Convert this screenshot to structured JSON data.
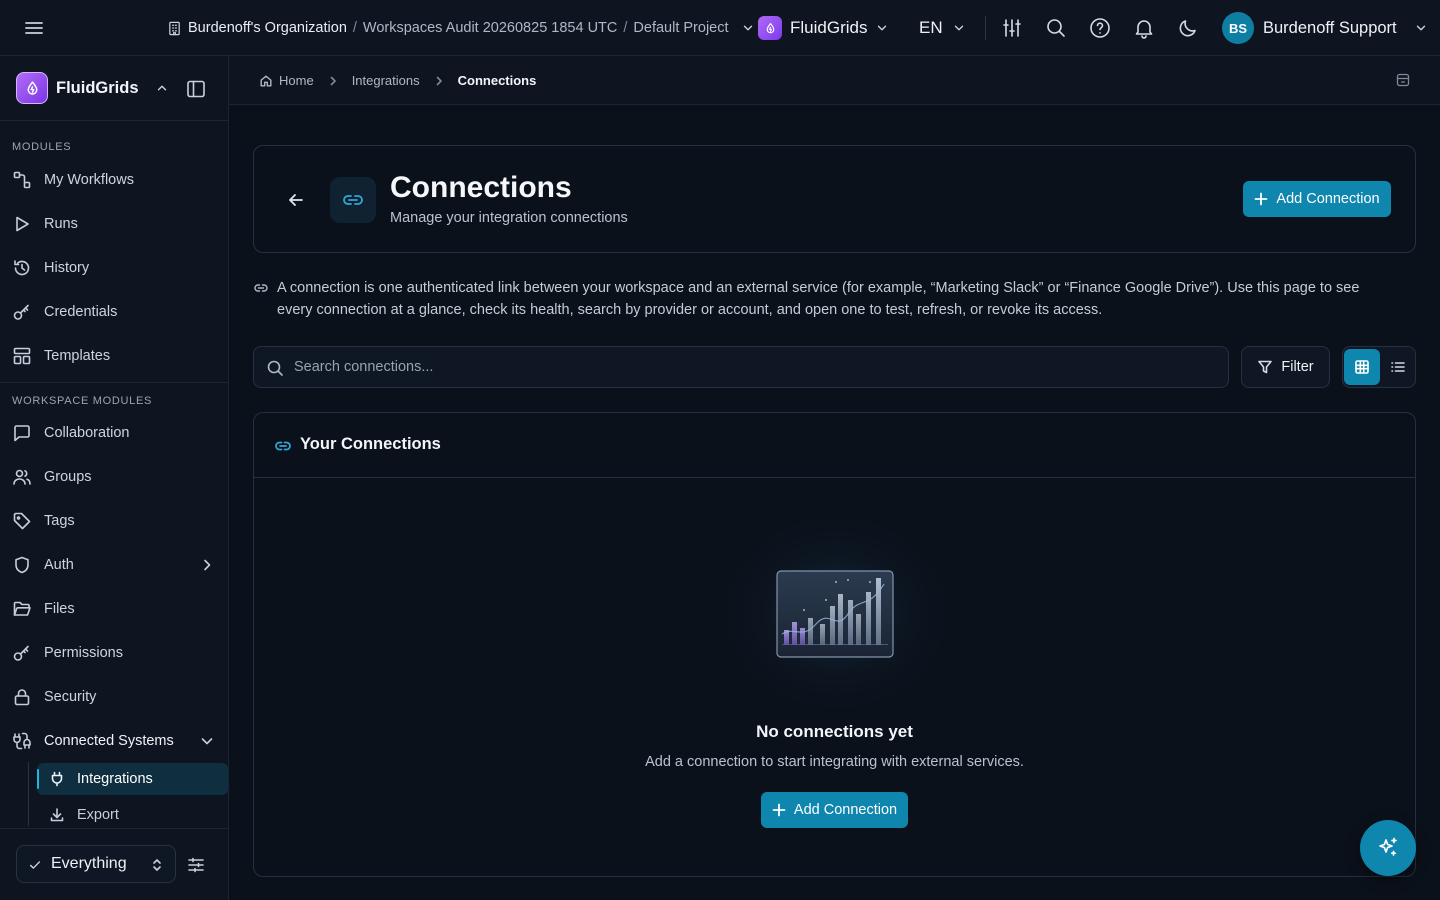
{
  "topbar": {
    "org_name": "Burdenoff's Organization",
    "path_separator": "/",
    "workspace_name": "Workspaces Audit 20260825 1854 UTC",
    "project_name": "Default Project",
    "app_name": "FluidGrids",
    "language": "EN",
    "user_initials": "BS",
    "user_name": "Burdenoff Support"
  },
  "sidebar": {
    "brand_name": "FluidGrids",
    "modules_label": "MODULES",
    "modules": [
      {
        "label": "My Workflows",
        "icon": "workflow-icon"
      },
      {
        "label": "Runs",
        "icon": "play-icon"
      },
      {
        "label": "History",
        "icon": "history-icon"
      },
      {
        "label": "Credentials",
        "icon": "key-icon"
      },
      {
        "label": "Templates",
        "icon": "templates-icon"
      }
    ],
    "workspace_label": "WORKSPACE MODULES",
    "workspace_modules": [
      {
        "label": "Collaboration",
        "icon": "chat-icon"
      },
      {
        "label": "Groups",
        "icon": "users-icon"
      },
      {
        "label": "Tags",
        "icon": "tag-icon"
      },
      {
        "label": "Auth",
        "icon": "shield-icon"
      },
      {
        "label": "Files",
        "icon": "folder-icon"
      },
      {
        "label": "Permissions",
        "icon": "key-icon"
      },
      {
        "label": "Security",
        "icon": "lock-icon"
      },
      {
        "label": "Connected Systems",
        "icon": "connected-systems-icon"
      }
    ],
    "sub_items": [
      {
        "label": "Integrations",
        "icon": "plug-icon",
        "active": true
      },
      {
        "label": "Export",
        "icon": "download-icon",
        "active": false
      }
    ],
    "scope_value": "Everything"
  },
  "breadcrumb": {
    "items": [
      "Home",
      "Integrations",
      "Connections"
    ]
  },
  "header": {
    "title": "Connections",
    "subtitle": "Manage your integration connections",
    "add_button": "Add Connection"
  },
  "info_text": "A connection is one authenticated link between your workspace and an external service (for example, “Marketing Slack” or “Finance Google Drive”). Use this page to see every connection at a glance, check its health, search by provider or account, and open one to test, refresh, or revoke its access.",
  "search": {
    "placeholder": "Search connections..."
  },
  "toolbar": {
    "filter_label": "Filter",
    "view_mode": "grid"
  },
  "connections": {
    "title": "Your Connections",
    "items": [],
    "empty_title": "No connections yet",
    "empty_subtitle": "Add a connection to start integrating with external services.",
    "empty_button": "Add Connection"
  },
  "colors": {
    "accent": "#0e86ad",
    "brand": "#8b45f0",
    "background": "#0b111b",
    "surface": "#0e1521"
  }
}
